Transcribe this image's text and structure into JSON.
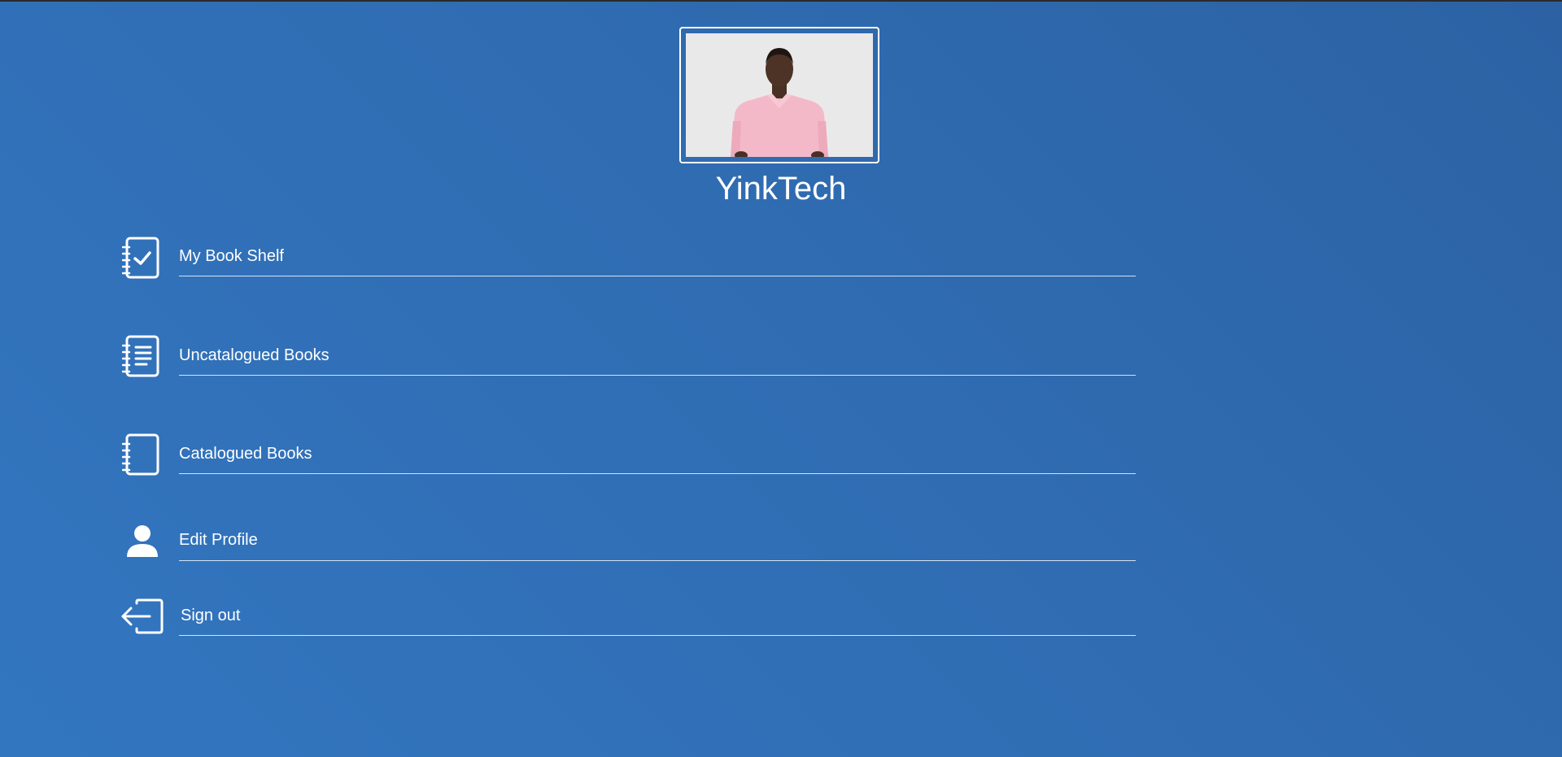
{
  "profile": {
    "username": "YinkTech",
    "avatar_alt": "Profile photo"
  },
  "menu": {
    "items": [
      {
        "label": "My Book Shelf",
        "icon": "notebook-check-icon"
      },
      {
        "label": "Uncatalogued Books",
        "icon": "notebook-list-icon"
      },
      {
        "label": "Catalogued Books",
        "icon": "notebook-icon"
      },
      {
        "label": "Edit Profile",
        "icon": "user-icon"
      },
      {
        "label": "Sign out",
        "icon": "sign-out-icon"
      }
    ]
  },
  "colors": {
    "background": "#306db3",
    "text": "#ffffff",
    "photo_background": "#e9e9ea",
    "shirt": "#f4b9c8"
  }
}
